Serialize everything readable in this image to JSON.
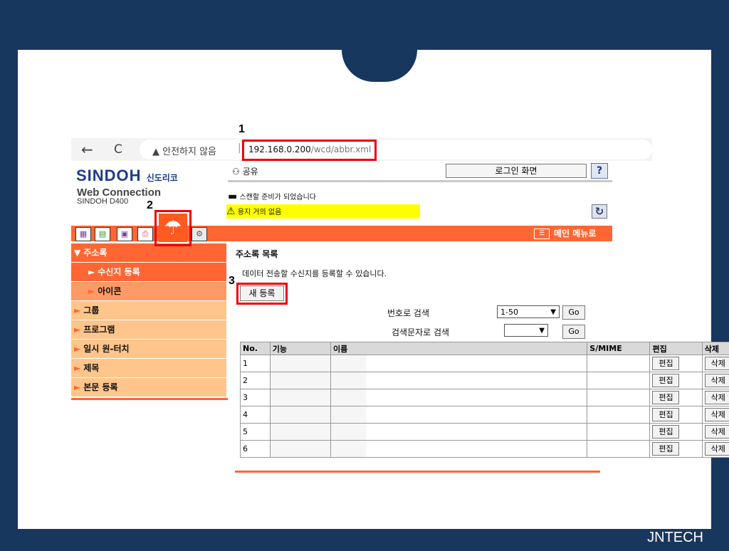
{
  "browser": {
    "back_icon": "←",
    "reload_icon": "C",
    "security_warning": "▲ 안전하지 않음",
    "separator": "|",
    "url_host": "192.168.0.200",
    "url_path": "/wcd/abbr.xml"
  },
  "brand": {
    "logo": "SINDOH",
    "logo_kr": "신도리코",
    "web_connection": "Web Connection",
    "model": "SINDOH D400"
  },
  "header": {
    "user": "공유",
    "login_button": "로그인 화면",
    "help_button": "?",
    "status_scan": "스캔할 준비가 되었습니다",
    "status_paper": "용지 거의 없음",
    "main_menu": "메인 메뉴로"
  },
  "tabs": [
    {
      "icon": "device-info-icon",
      "glyph": "▦"
    },
    {
      "icon": "job-icon",
      "glyph": "▤"
    },
    {
      "icon": "box-icon",
      "glyph": "▣"
    },
    {
      "icon": "print-icon",
      "glyph": "⎙"
    },
    {
      "icon": "store-address-icon",
      "glyph": "☂"
    },
    {
      "icon": "settings-icon",
      "glyph": "⚙"
    }
  ],
  "sidebar": {
    "address_book": "주소록",
    "recipient_registration": "수신지 등록",
    "icon": "아이콘",
    "group": "그룹",
    "program": "프로그램",
    "one_touch": "일시 원-터치",
    "subject": "제목",
    "body": "본문 등록"
  },
  "content": {
    "title": "주소록 목록",
    "description": "데이터 전송할 수신지를 등록할 수 있습니다.",
    "new_button": "새 등록",
    "search_by_number": "번호로 검색",
    "search_by_text": "검색문자로 검색",
    "number_select_value": "1-50",
    "text_select_value": "",
    "go_label": "Go"
  },
  "table": {
    "headers": [
      "No.",
      "기능",
      "이름",
      "S/MIME",
      "편집",
      "삭제"
    ],
    "rows": [
      "1",
      "2",
      "3",
      "4",
      "5",
      "6"
    ],
    "edit_label": "편집",
    "delete_label": "삭제"
  },
  "annotations": {
    "step1": "1",
    "step2": "2",
    "step3": "3"
  },
  "footer": {
    "brand": "JNTECH"
  },
  "colors": {
    "frame": "#17375e",
    "accent": "#ff6633",
    "sidebar_light": "#ffc58a",
    "highlight": "#e00000",
    "warning_bg": "#ffff00"
  }
}
